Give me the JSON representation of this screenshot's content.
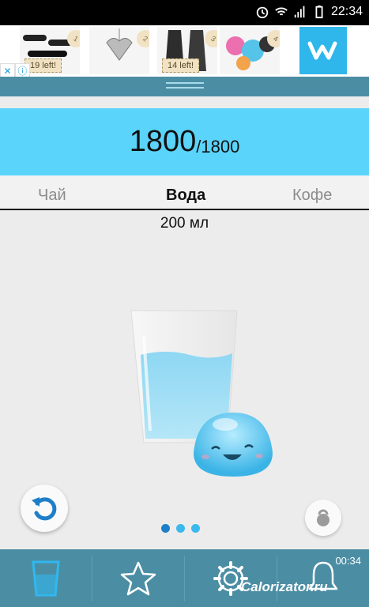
{
  "status_bar": {
    "time": "22:34",
    "icons": [
      "alarm-icon",
      "wifi-icon",
      "signal-icon",
      "battery-icon"
    ]
  },
  "ad": {
    "brand_icon": "wish-logo",
    "products": [
      {
        "tag": "1",
        "left_text": "19 left!"
      },
      {
        "tag": "2",
        "left_text": ""
      },
      {
        "tag": "3",
        "left_text": "14 left!"
      },
      {
        "tag": "4",
        "left_text": ""
      }
    ]
  },
  "counter": {
    "current": "1800",
    "separator": "/",
    "goal": "1800"
  },
  "tabs": [
    {
      "label": "Чай"
    },
    {
      "label": "Вода",
      "active": true
    },
    {
      "label": "Кофе"
    }
  ],
  "volume": "200 мл",
  "pager": {
    "pages": 3,
    "active": 0
  },
  "bottom_nav": {
    "items": [
      "glass-icon",
      "star-icon",
      "gear-icon",
      "bell-icon"
    ],
    "alarm_time": "00:34"
  },
  "watermark": "Calorizator.ru",
  "colors": {
    "accent": "#5ad4fa",
    "nav": "#4b8ea4",
    "pager_active": "#1f7ec8"
  }
}
